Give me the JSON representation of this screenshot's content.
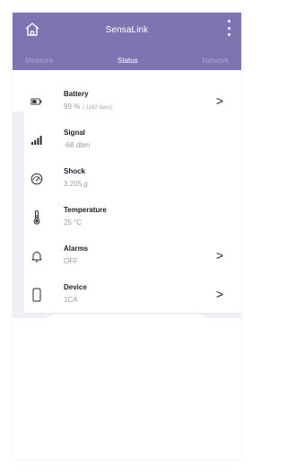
{
  "app": {
    "title": "SensaLink",
    "accent": "#7f74b2"
  },
  "tabs": [
    {
      "label": "Measure",
      "active": false
    },
    {
      "label": "Status",
      "active": true
    },
    {
      "label": "Network",
      "active": false
    }
  ],
  "status_items": [
    {
      "name": "Battery",
      "value": "99 %",
      "detail": "( 1162 days)",
      "icon": "battery-icon",
      "has_chevron": true
    },
    {
      "name": "Signal",
      "value": "-68 dbm",
      "icon": "signal-icon",
      "has_chevron": false
    },
    {
      "name": "Shock",
      "value": "3.205 g",
      "icon": "gauge-icon",
      "has_chevron": false
    },
    {
      "name": "Temperature",
      "value": "25 °C",
      "icon": "thermometer-icon",
      "has_chevron": false
    },
    {
      "name": "Alarms",
      "value": "OFF",
      "icon": "bell-icon",
      "has_chevron": true
    },
    {
      "name": "Device",
      "value": "1CA",
      "icon": "phone-icon",
      "has_chevron": true
    }
  ],
  "chevron": ">"
}
